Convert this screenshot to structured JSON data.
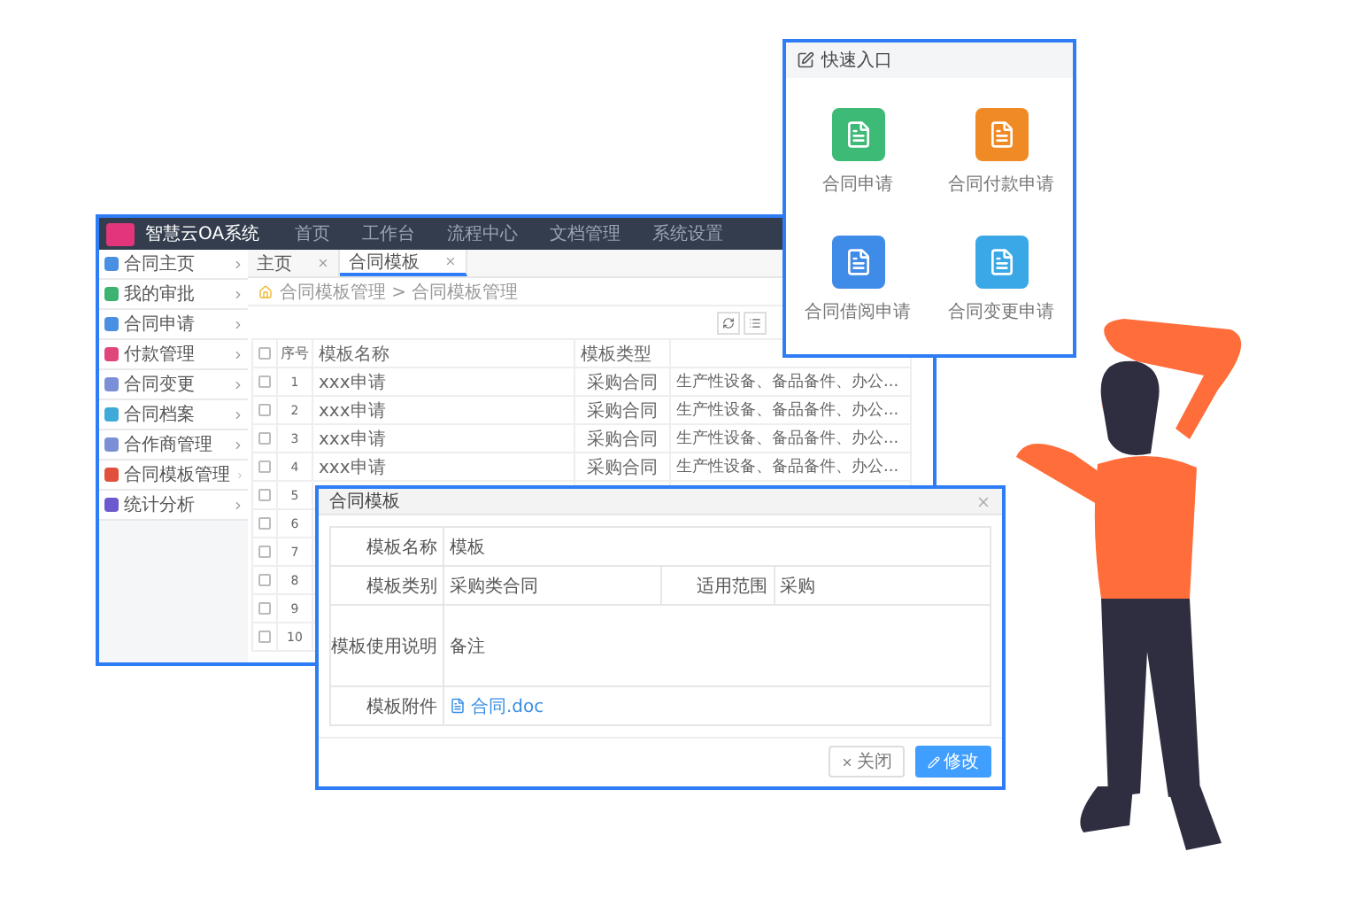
{
  "app": {
    "logo": "智慧云OA系统",
    "nav": [
      "首页",
      "工作台",
      "流程中心",
      "文档管理",
      "系统设置"
    ],
    "sidebar": [
      {
        "label": "合同主页",
        "color": "#4a90e2"
      },
      {
        "label": "我的审批",
        "color": "#3cb371"
      },
      {
        "label": "合同申请",
        "color": "#4a90e2"
      },
      {
        "label": "付款管理",
        "color": "#e0457b"
      },
      {
        "label": "合同变更",
        "color": "#7b8fd6"
      },
      {
        "label": "合同档案",
        "color": "#3fa9d9"
      },
      {
        "label": "合作商管理",
        "color": "#7b8fd6"
      },
      {
        "label": "合同模板管理",
        "color": "#e0503c"
      },
      {
        "label": "统计分析",
        "color": "#6a5acd"
      }
    ],
    "tabs": [
      {
        "label": "主页",
        "selected": false
      },
      {
        "label": "合同模板",
        "selected": true
      }
    ],
    "breadcrumb": "合同模板管理 > 合同模板管理",
    "table": {
      "all_checked": false,
      "columns": [
        "序号",
        "模板名称",
        "模板类型"
      ],
      "rows": [
        {
          "checked": false,
          "no": "1",
          "name": "xxx申请",
          "type": "采购合同",
          "remark": "生产性设备、备品备件、办公..."
        },
        {
          "checked": false,
          "no": "2",
          "name": "xxx申请",
          "type": "采购合同",
          "remark": "生产性设备、备品备件、办公..."
        },
        {
          "checked": false,
          "no": "3",
          "name": "xxx申请",
          "type": "采购合同",
          "remark": "生产性设备、备品备件、办公..."
        },
        {
          "checked": false,
          "no": "4",
          "name": "xxx申请",
          "type": "采购合同",
          "remark": "生产性设备、备品备件、办公..."
        },
        {
          "checked": false,
          "no": "5"
        },
        {
          "checked": false,
          "no": "6"
        },
        {
          "checked": false,
          "no": "7"
        },
        {
          "checked": false,
          "no": "8"
        },
        {
          "checked": false,
          "no": "9"
        },
        {
          "checked": false,
          "no": "10"
        }
      ]
    }
  },
  "quick_entry": {
    "title": "快速入口",
    "items": [
      {
        "label": "合同申请",
        "color": "#3dba76"
      },
      {
        "label": "合同付款申请",
        "color": "#f08a24"
      },
      {
        "label": "合同借阅申请",
        "color": "#3f8be8"
      },
      {
        "label": "合同变更申请",
        "color": "#3aa7e6"
      }
    ]
  },
  "modal": {
    "title": "合同模板",
    "rows": [
      [
        {
          "label": "模板名称",
          "value": "模板",
          "kind": "text"
        }
      ],
      [
        {
          "label": "模板类别",
          "value": "采购类合同",
          "kind": "text"
        },
        {
          "label": "适用范围",
          "value": "采购",
          "kind": "text"
        }
      ],
      [
        {
          "label": "模板使用说明",
          "value": "备注",
          "kind": "tall"
        }
      ],
      [
        {
          "label": "模板附件",
          "value": "合同.doc",
          "kind": "file"
        }
      ]
    ],
    "buttons": [
      {
        "label": "关闭",
        "kind": "default"
      },
      {
        "label": "修改",
        "kind": "primary"
      }
    ]
  }
}
